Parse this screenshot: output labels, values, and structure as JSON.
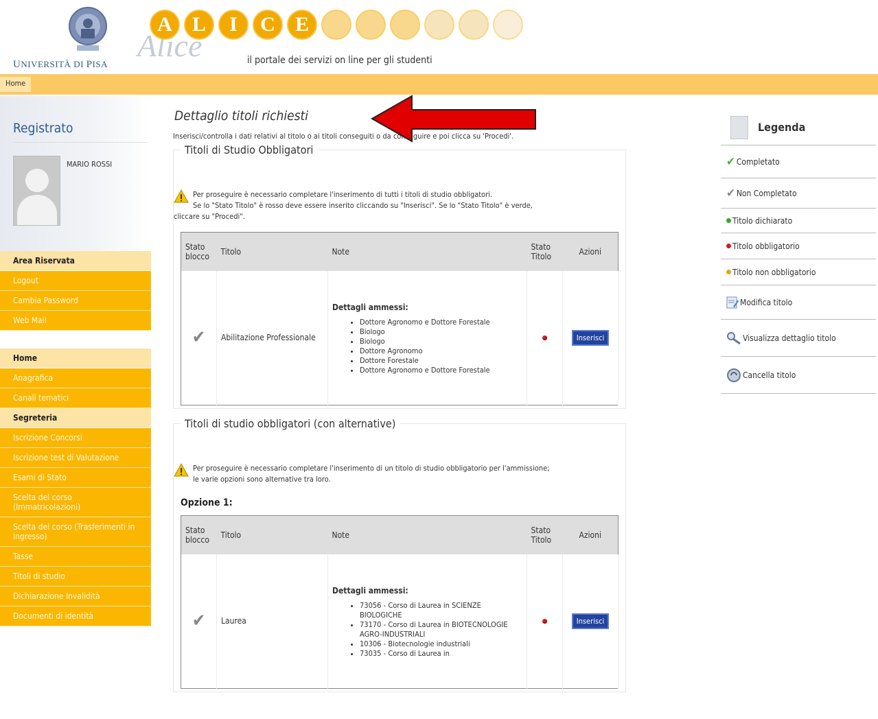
{
  "header": {
    "uni_name_big1": "U",
    "uni_name_small1": "NIVERSITÀ DI ",
    "uni_name_big2": "P",
    "uni_name_small2": "ISA",
    "alice_letters": [
      "A",
      "L",
      "I",
      "C",
      "E"
    ],
    "alice_script": "Alice",
    "tagline": "il portale dei servizi on line per gli studenti"
  },
  "topnav": {
    "home": "Home"
  },
  "sidebar": {
    "registered": "Registrato",
    "username": "MARIO ROSSI",
    "area_riservata": {
      "title": "Area Riservata",
      "items": [
        "Logout",
        "Cambia Password",
        "Web Mail"
      ]
    },
    "home_menu": {
      "title": "Home",
      "items_before": [
        "Anagrafica",
        "Canali tematici"
      ],
      "section": "Segreteria",
      "items_after": [
        "Iscrizione Concorsi",
        "Iscrizione test di Valutazione",
        "Esami di Stato",
        "Scelta del corso (Immatricolazioni)",
        "Scelta del corso (Trasferimenti in ingresso)",
        "Tasse",
        "Titoli di studio",
        "Dichiarazione Invalidità",
        "Documenti di identità"
      ]
    }
  },
  "main": {
    "title": "Dettaglio titoli richiesti",
    "intro": "Inserisci/controlla i dati relativi al titolo o ai titoli conseguiti o da conseguire e poi clicca su 'Procedi'.",
    "section1": {
      "legend": "Titoli di Studio Obbligatori",
      "warning_line1": "Per proseguire è necessario completare l'inserimento di tutti i titoli di studio obbligatori.",
      "warning_line2": "Se lo \"Stato Titolo\" è rosso deve essere inserito cliccando su \"Inserisci\". Se lo \"Stato Titolo\" è verde,",
      "warning_line3": "cliccare su \"Procedi\".",
      "table": {
        "headers": [
          "Stato blocco",
          "Titolo",
          "Note",
          "Stato Titolo",
          "Azioni"
        ],
        "row": {
          "titolo": "Abilitazione Professionale",
          "note_head": "Dettagli ammessi:",
          "note_items": [
            "Dottore Agronomo e Dottore Forestale",
            "Biologo",
            "Biologo",
            "Dottore Agronomo",
            "Dottore Forestale",
            "Dottore Agronomo e Dottore Forestale"
          ],
          "action": "Inserisci"
        }
      }
    },
    "section2": {
      "legend": "Titoli di studio obbligatori (con alternative)",
      "warning_line1": "Per proseguire è necessario completare l'inserimento di un titolo di studio obbligatorio per l'ammissione;",
      "warning_line2": "le varie opzioni sono alternative tra loro.",
      "option_label": "Opzione 1:",
      "table": {
        "headers": [
          "Stato blocco",
          "Titolo",
          "Note",
          "Stato Titolo",
          "Azioni"
        ],
        "row": {
          "titolo": "Laurea",
          "note_head": "Dettagli ammessi:",
          "note_items": [
            "73056 - Corso di Laurea in SCIENZE BIOLOGICHE",
            "73170 - Corso di Laurea in BIOTECNOLOGIE AGRO-INDUSTRIALI",
            "10306 - Biotecnologie industriali",
            "73035 - Corso di Laurea in"
          ],
          "action": "Inserisci"
        }
      }
    }
  },
  "legend_panel": {
    "title": "Legenda",
    "items": [
      "Completato",
      "Non Completato",
      "Titolo dichiarato",
      "Titolo obbligatorio",
      "Titolo non obbligatorio",
      "Modifica titolo",
      "Visualizza dettaglio titolo",
      "Cancella titolo"
    ]
  },
  "colors": {
    "menu_orange": "#fab600",
    "menu_light": "#fce3a6",
    "topnav": "#fbc964",
    "link_blue": "#2e5a8c",
    "button_blue": "#22449e",
    "status_red": "#d21e1e",
    "status_green": "#2fa82f",
    "status_orange": "#e8a21a",
    "annotation_arrow": "#e00000"
  }
}
